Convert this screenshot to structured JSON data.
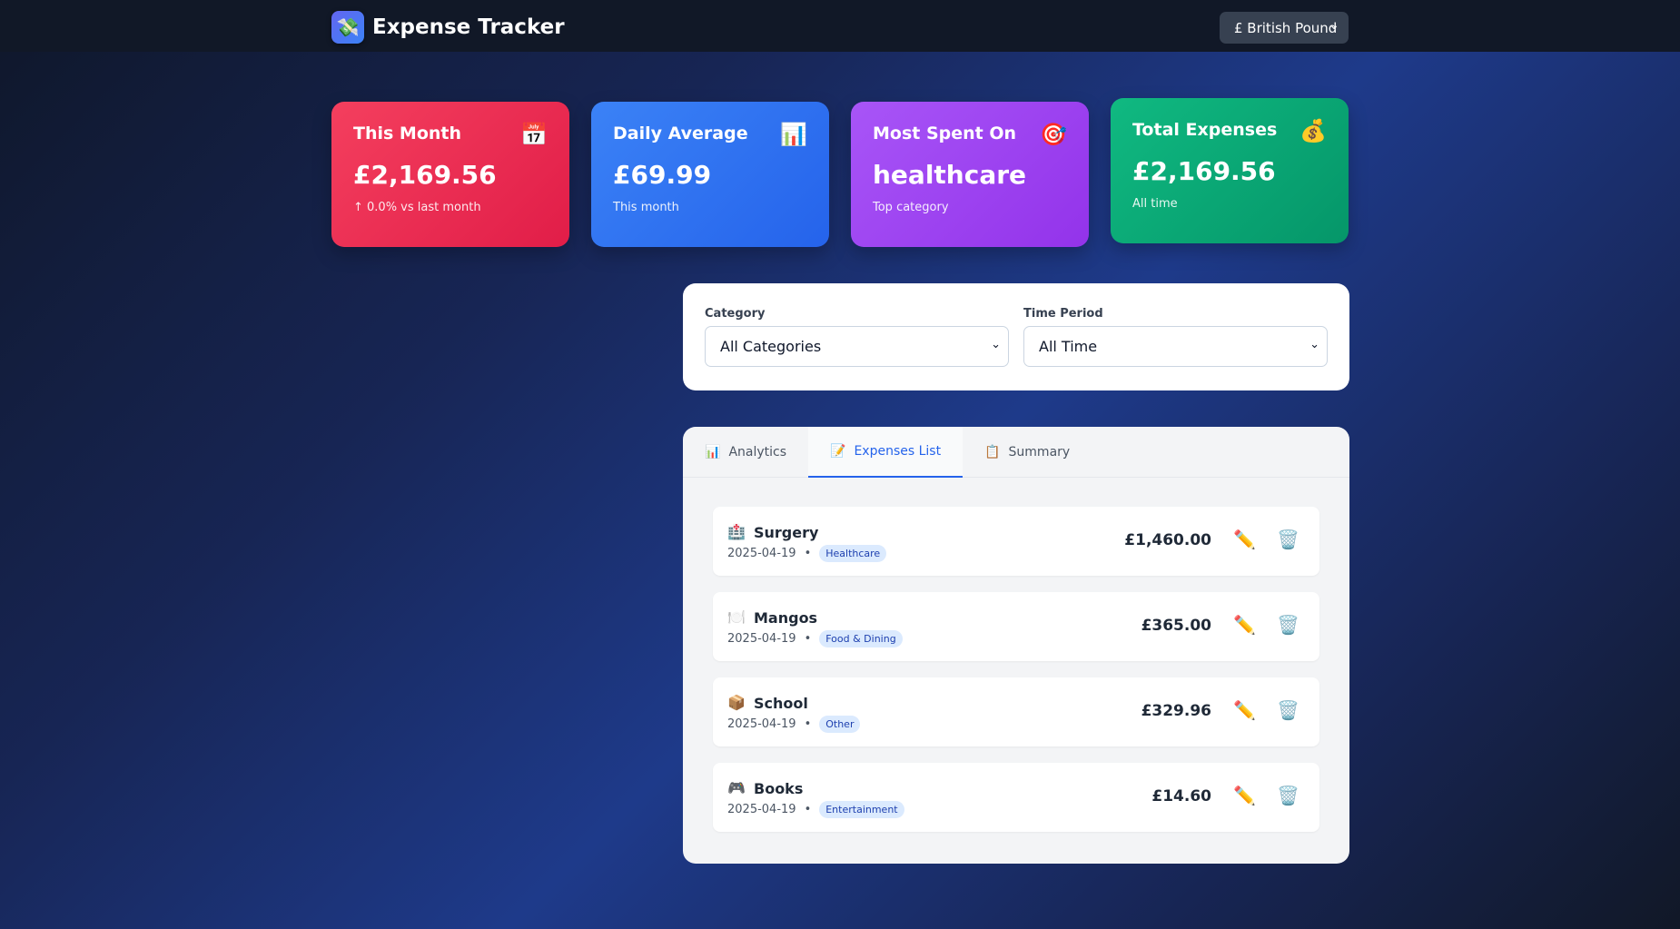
{
  "header": {
    "logo_glyph": "💸",
    "title": "Expense Tracker",
    "currency": "£ British Pound"
  },
  "cards": [
    {
      "title": "This Month",
      "icon": "📅",
      "value": "£2,169.56",
      "sub": "↑ 0.0% vs last month"
    },
    {
      "title": "Daily Average",
      "icon": "📊",
      "value": "£69.99",
      "sub": "This month"
    },
    {
      "title": "Most Spent On",
      "icon": "🎯",
      "value": "healthcare",
      "sub": "Top category"
    },
    {
      "title": "Total Expenses",
      "icon": "💰",
      "value": "£2,169.56",
      "sub": "All time"
    }
  ],
  "filters": {
    "category_label": "Category",
    "category_value": "All Categories",
    "period_label": "Time Period",
    "period_value": "All Time"
  },
  "tabs": [
    {
      "icon": "📊",
      "label": "Analytics"
    },
    {
      "icon": "📝",
      "label": "Expenses List"
    },
    {
      "icon": "📋",
      "label": "Summary"
    }
  ],
  "expenses": [
    {
      "icon": "🏥",
      "name": "Surgery",
      "date": "2025-04-19",
      "category": "Healthcare",
      "amount": "£1,460.00"
    },
    {
      "icon": "🍽️",
      "name": "Mangos",
      "date": "2025-04-19",
      "category": "Food & Dining",
      "amount": "£365.00"
    },
    {
      "icon": "📦",
      "name": "School",
      "date": "2025-04-19",
      "category": "Other",
      "amount": "£329.96"
    },
    {
      "icon": "🎮",
      "name": "Books",
      "date": "2025-04-19",
      "category": "Entertainment",
      "amount": "£14.60"
    }
  ],
  "actions": {
    "edit_icon": "✏️",
    "delete_icon": "🗑️",
    "separator": "•"
  },
  "colors": {
    "accent": "#2563eb",
    "red": "#e11d48",
    "blue": "#2563eb",
    "purple": "#9333ea",
    "green": "#059669"
  }
}
